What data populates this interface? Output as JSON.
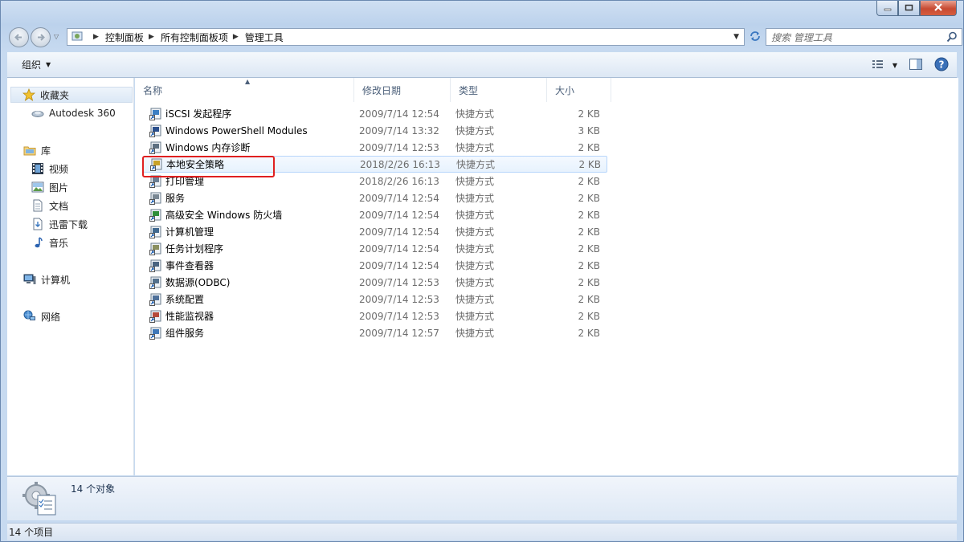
{
  "window": {
    "min_icon": "minimize-icon",
    "max_icon": "maximize-icon",
    "close_icon": "close-icon"
  },
  "address": {
    "crumbs": [
      "控制面板",
      "所有控制面板项",
      "管理工具"
    ],
    "search_placeholder": "搜索 管理工具"
  },
  "toolbar": {
    "organize": "组织"
  },
  "nav": {
    "favorites": "收藏夹",
    "autodesk": "Autodesk 360",
    "library": "库",
    "videos": "视频",
    "pictures": "图片",
    "documents": "文档",
    "xunlei": "迅雷下载",
    "music": "音乐",
    "computer": "计算机",
    "network": "网络"
  },
  "columns": {
    "name": "名称",
    "date": "修改日期",
    "type": "类型",
    "size": "大小"
  },
  "files": [
    {
      "name": "iSCSI 发起程序",
      "date": "2009/7/14 12:54",
      "type": "快捷方式",
      "size": "2 KB",
      "color": "#3b7fc4"
    },
    {
      "name": "Windows PowerShell Modules",
      "date": "2009/7/14 13:32",
      "type": "快捷方式",
      "size": "3 KB",
      "color": "#2a4f8c"
    },
    {
      "name": "Windows 内存诊断",
      "date": "2009/7/14 12:53",
      "type": "快捷方式",
      "size": "2 KB",
      "color": "#5d6f80"
    },
    {
      "name": "本地安全策略",
      "date": "2018/2/26 16:13",
      "type": "快捷方式",
      "size": "2 KB",
      "color": "#c9a227"
    },
    {
      "name": "打印管理",
      "date": "2018/2/26 16:13",
      "type": "快捷方式",
      "size": "2 KB",
      "color": "#6b7e93"
    },
    {
      "name": "服务",
      "date": "2009/7/14 12:54",
      "type": "快捷方式",
      "size": "2 KB",
      "color": "#7a8894"
    },
    {
      "name": "高级安全 Windows 防火墙",
      "date": "2009/7/14 12:54",
      "type": "快捷方式",
      "size": "2 KB",
      "color": "#2f8f3a"
    },
    {
      "name": "计算机管理",
      "date": "2009/7/14 12:54",
      "type": "快捷方式",
      "size": "2 KB",
      "color": "#41698f"
    },
    {
      "name": "任务计划程序",
      "date": "2009/7/14 12:54",
      "type": "快捷方式",
      "size": "2 KB",
      "color": "#8a8f60"
    },
    {
      "name": "事件查看器",
      "date": "2009/7/14 12:54",
      "type": "快捷方式",
      "size": "2 KB",
      "color": "#4a6480"
    },
    {
      "name": "数据源(ODBC)",
      "date": "2009/7/14 12:53",
      "type": "快捷方式",
      "size": "2 KB",
      "color": "#53708c"
    },
    {
      "name": "系统配置",
      "date": "2009/7/14 12:53",
      "type": "快捷方式",
      "size": "2 KB",
      "color": "#4d6f99"
    },
    {
      "name": "性能监视器",
      "date": "2009/7/14 12:53",
      "type": "快捷方式",
      "size": "2 KB",
      "color": "#b54a3a"
    },
    {
      "name": "组件服务",
      "date": "2009/7/14 12:57",
      "type": "快捷方式",
      "size": "2 KB",
      "color": "#3f78b8"
    }
  ],
  "details": {
    "count": "14 个对象"
  },
  "status": {
    "text": "14 个项目"
  }
}
